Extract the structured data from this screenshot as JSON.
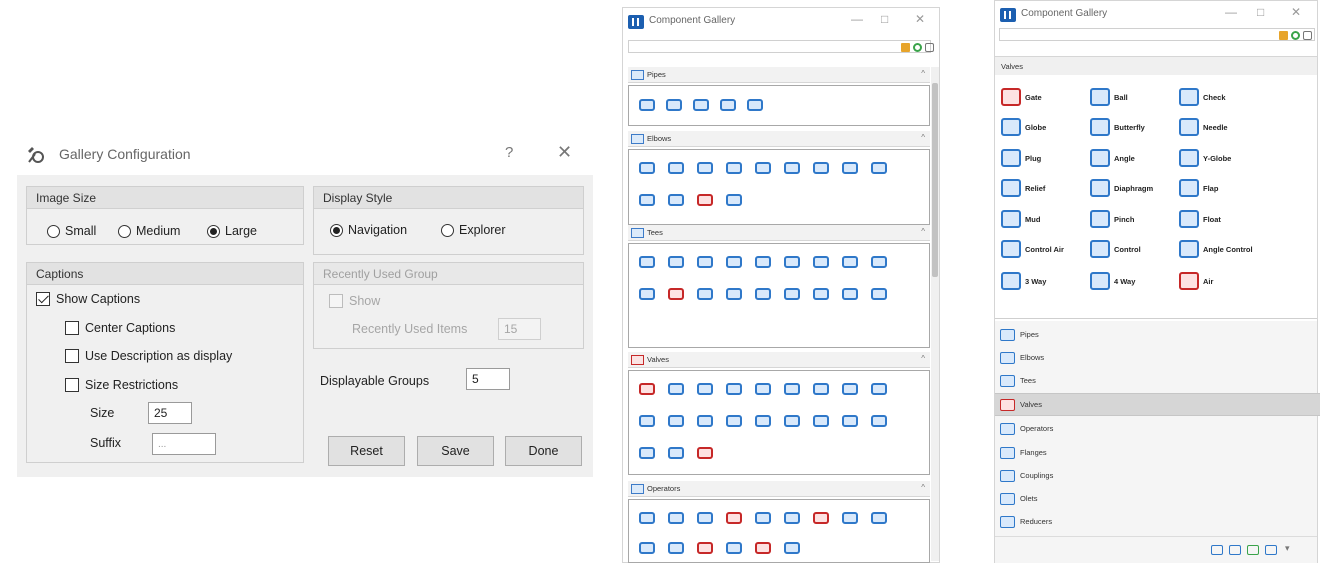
{
  "gallery_config": {
    "title": "Gallery Configuration",
    "help_glyph": "?",
    "close_glyph": "✕",
    "image_size": {
      "label": "Image Size",
      "options": [
        "Small",
        "Medium",
        "Large"
      ],
      "selected": "Large"
    },
    "display_style": {
      "label": "Display Style",
      "options": [
        "Navigation",
        "Explorer"
      ],
      "selected": "Navigation"
    },
    "captions": {
      "label": "Captions",
      "show_captions": "Show Captions",
      "center_captions": "Center Captions",
      "use_description": "Use Description as display",
      "size_restrictions": "Size Restrictions",
      "size_label": "Size",
      "size_value": "25",
      "suffix_label": "Suffix",
      "suffix_value": "..."
    },
    "recent": {
      "label": "Recently Used Group",
      "show": "Show",
      "items_label": "Recently Used Items",
      "items_value": "15"
    },
    "displayable": {
      "label": "Displayable Groups",
      "value": "5"
    },
    "buttons": {
      "reset": "Reset",
      "save": "Save",
      "done": "Done"
    }
  },
  "gallery_nav": {
    "title": "Component Gallery",
    "sections": [
      "Pipes",
      "Elbows",
      "Tees",
      "Valves",
      "Operators"
    ]
  },
  "gallery_explorer": {
    "title": "Component Gallery",
    "section_title": "Valves",
    "valves": [
      "Gate",
      "Ball",
      "Check",
      "Globe",
      "Butterfly",
      "Needle",
      "Plug",
      "Angle",
      "Y-Globe",
      "Relief",
      "Diaphragm",
      "Flap",
      "Mud",
      "Pinch",
      "Float",
      "Control Air",
      "Control",
      "Angle Control",
      "3 Way",
      "4 Way",
      "Air"
    ],
    "nav": [
      "Pipes",
      "Elbows",
      "Tees",
      "Valves",
      "Operators",
      "Flanges",
      "Couplings",
      "Olets",
      "Reducers"
    ],
    "selected_nav": "Valves"
  },
  "colors": {
    "accent": "#2f78c9",
    "valve_red": "#c62828",
    "dialog_bg": "#f0f0f0"
  }
}
